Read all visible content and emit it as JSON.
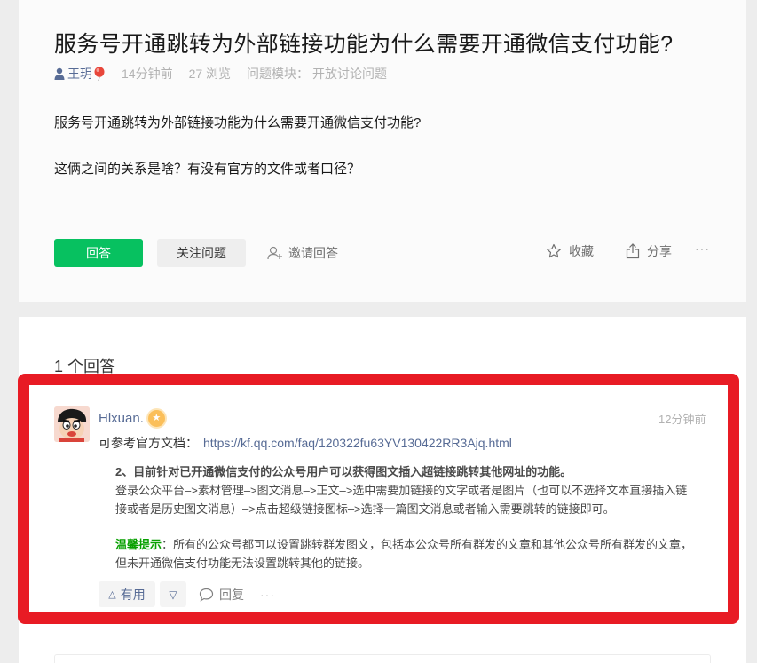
{
  "question": {
    "title": "服务号开通跳转为外部链接功能为什么需要开通微信支付功能?",
    "author": "王玥",
    "time": "14分钟前",
    "views": "27 浏览",
    "module_label": "问题模块：",
    "module_value": "开放讨论问题",
    "body": [
      "服务号开通跳转为外部链接功能为什么需要开通微信支付功能?",
      "这俩之间的关系是啥？有没有官方的文件或者口径？"
    ],
    "buttons": {
      "answer": "回答",
      "follow": "关注问题",
      "invite": "邀请回答",
      "favorite": "收藏",
      "share": "分享",
      "more": "···"
    }
  },
  "answers": {
    "count_label": "1 个回答",
    "items": [
      {
        "author": "Hlxuan.",
        "time": "12分钟前",
        "ref_label": "可参考官方文档：",
        "ref_link": "https://kf.qq.com/faq/120322fu63YV130422RR3Ajq.html",
        "quote_heading": "2、目前针对已开通微信支付的公众号用户可以获得图文插入超链接跳转其他网址的功能。",
        "quote_line1": "登录公众平台–>素材管理–>图文消息–>正文–>选中需要加链接的文字或者是图片（也可以不选择文本直接插入链",
        "quote_line2": "接或者是历史图文消息）–>点击超级链接图标–>选择一篇图文消息或者输入需要跳转的链接即可。",
        "tip_label": "温馨提示",
        "tip_line1": "：所有的公众号都可以设置跳转群发图文，包括本公众号所有群发的文章和其他公众号所有群发的文章，",
        "tip_line2": "但未开通微信支付功能无法设置跳转其他的链接。",
        "useful_label": "有用",
        "reply_label": "回复",
        "more": "···"
      }
    ]
  },
  "colors": {
    "accent_green": "#07c160",
    "link_blue": "#576b95",
    "highlight_red": "#e81b24"
  }
}
